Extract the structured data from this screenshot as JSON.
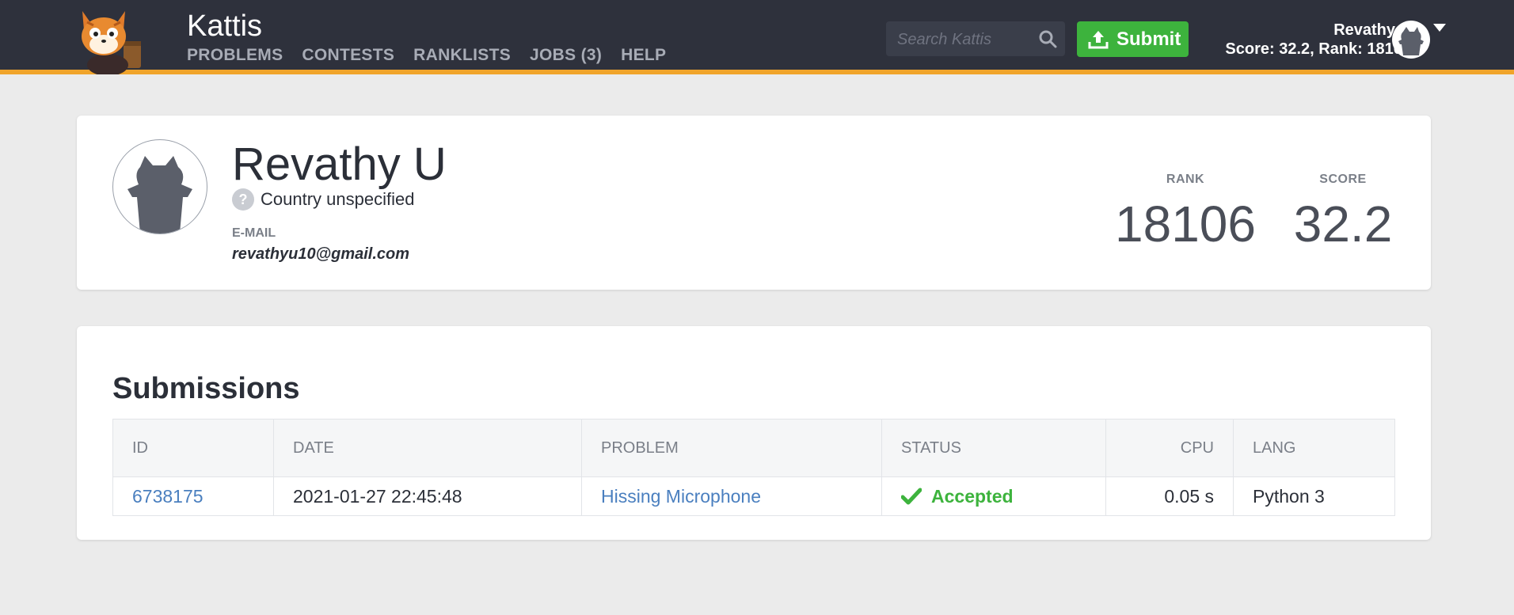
{
  "brand": {
    "name": "Kattis"
  },
  "nav": [
    {
      "label": "PROBLEMS"
    },
    {
      "label": "CONTESTS"
    },
    {
      "label": "RANKLISTS"
    },
    {
      "label": "JOBS (3)"
    },
    {
      "label": "HELP"
    }
  ],
  "search": {
    "placeholder": "Search Kattis",
    "value": ""
  },
  "submit": {
    "label": "Submit"
  },
  "user": {
    "name": "Revathy U",
    "summary": "Score: 32.2, Rank: 18106"
  },
  "profile": {
    "name": "Revathy U",
    "country": "Country unspecified",
    "country_icon": "?",
    "email_label": "E-MAIL",
    "email": "revathyu10@gmail.com",
    "rank_label": "RANK",
    "rank": "18106",
    "score_label": "SCORE",
    "score": "32.2"
  },
  "submissions": {
    "title": "Submissions",
    "columns": [
      "ID",
      "DATE",
      "PROBLEM",
      "STATUS",
      "CPU",
      "LANG"
    ],
    "rows": [
      {
        "id": "6738175",
        "date": "2021-01-27 22:45:48",
        "problem": "Hissing Microphone",
        "status": "Accepted",
        "cpu": "0.05 s",
        "lang": "Python 3"
      }
    ]
  },
  "colors": {
    "header": "#2e313c",
    "accent": "#f0a42b",
    "success": "#3db33d",
    "link": "#4a7fbf"
  }
}
